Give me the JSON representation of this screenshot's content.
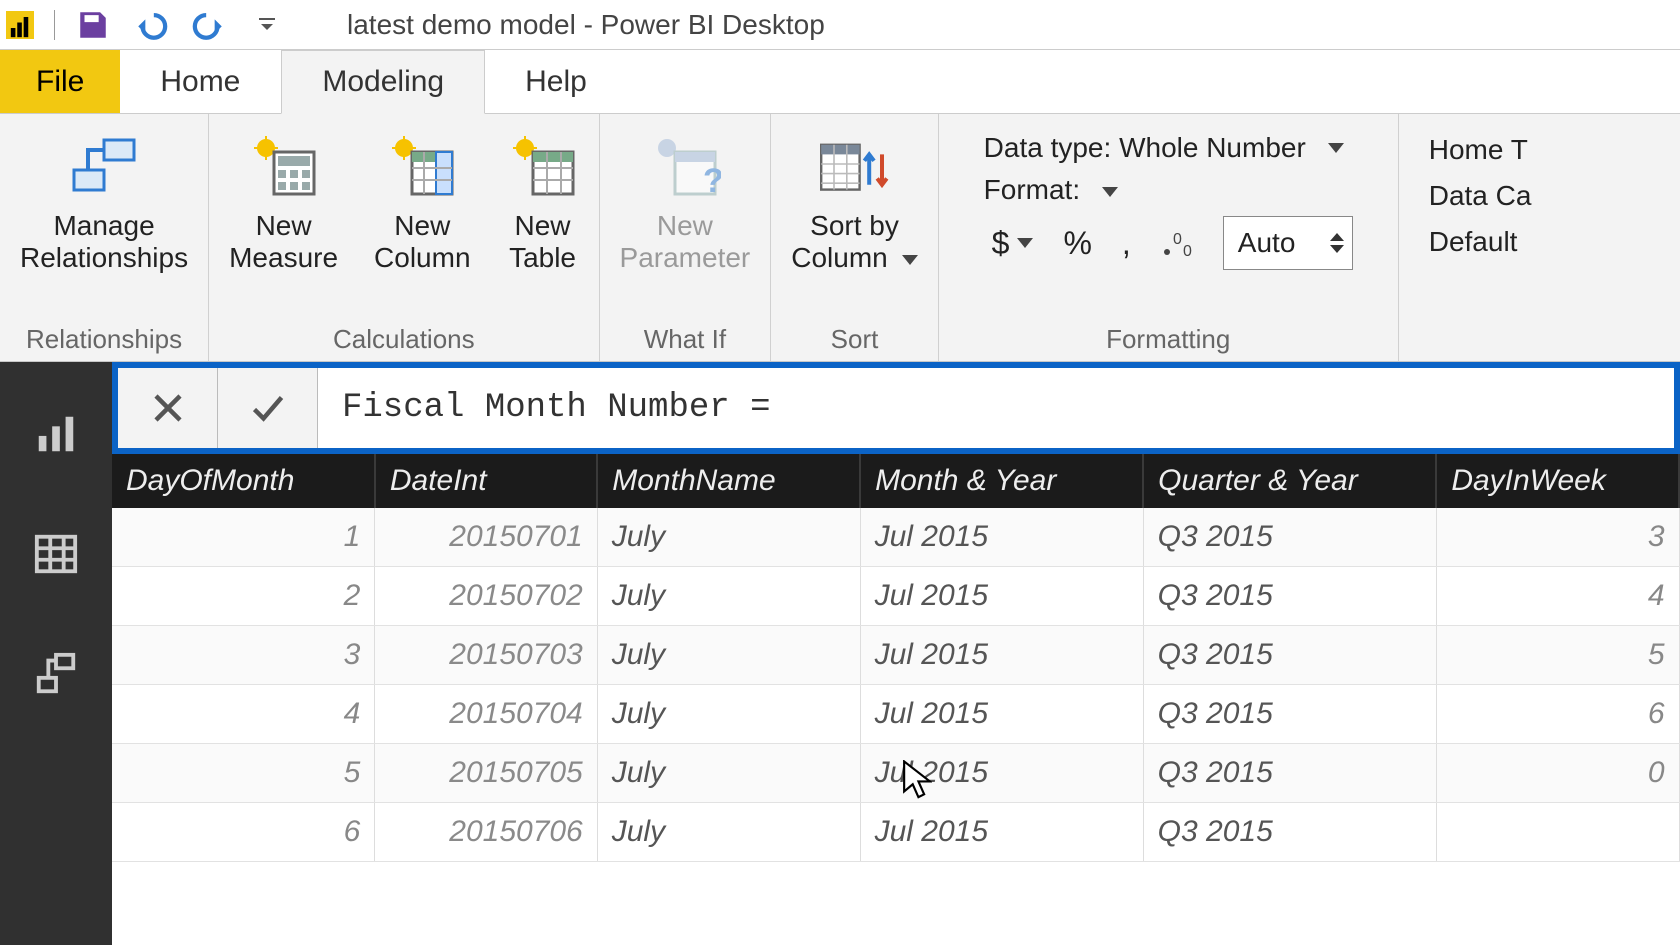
{
  "title": "latest demo model - Power BI Desktop",
  "menu": {
    "file": "File",
    "home": "Home",
    "modeling": "Modeling",
    "help": "Help"
  },
  "ribbon": {
    "relationships": {
      "manage1": "Manage",
      "manage2": "Relationships",
      "group": "Relationships"
    },
    "calculations": {
      "newMeasure1": "New",
      "newMeasure2": "Measure",
      "newColumn1": "New",
      "newColumn2": "Column",
      "newTable1": "New",
      "newTable2": "Table",
      "group": "Calculations"
    },
    "whatif": {
      "newParam1": "New",
      "newParam2": "Parameter",
      "group": "What If"
    },
    "sort": {
      "sortBy1": "Sort by",
      "sortBy2": "Column",
      "group": "Sort"
    },
    "formatting": {
      "typeLabel": "Data type: Whole Number",
      "formatLabel": "Format:",
      "currency": "$",
      "percent": "%",
      "comma": ",",
      "auto": "Auto",
      "group": "Formatting"
    },
    "properties": {
      "homeTable": "Home T",
      "dataCat": "Data Ca",
      "default": "Default"
    }
  },
  "formula": "Fiscal Month Number =",
  "table": {
    "headers": [
      "DayOfMonth",
      "DateInt",
      "MonthName",
      "Month & Year",
      "Quarter & Year",
      "DayInWeek"
    ],
    "rows": [
      {
        "day": "1",
        "dateint": "20150701",
        "month": "July",
        "my": "Jul 2015",
        "qy": "Q3 2015",
        "diw": "3"
      },
      {
        "day": "2",
        "dateint": "20150702",
        "month": "July",
        "my": "Jul 2015",
        "qy": "Q3 2015",
        "diw": "4"
      },
      {
        "day": "3",
        "dateint": "20150703",
        "month": "July",
        "my": "Jul 2015",
        "qy": "Q3 2015",
        "diw": "5"
      },
      {
        "day": "4",
        "dateint": "20150704",
        "month": "July",
        "my": "Jul 2015",
        "qy": "Q3 2015",
        "diw": "6"
      },
      {
        "day": "5",
        "dateint": "20150705",
        "month": "July",
        "my": "Jul 2015",
        "qy": "Q3 2015",
        "diw": "0"
      },
      {
        "day": "6",
        "dateint": "20150706",
        "month": "July",
        "my": "Jul 2015",
        "qy": "Q3 2015",
        "diw": ""
      }
    ]
  }
}
